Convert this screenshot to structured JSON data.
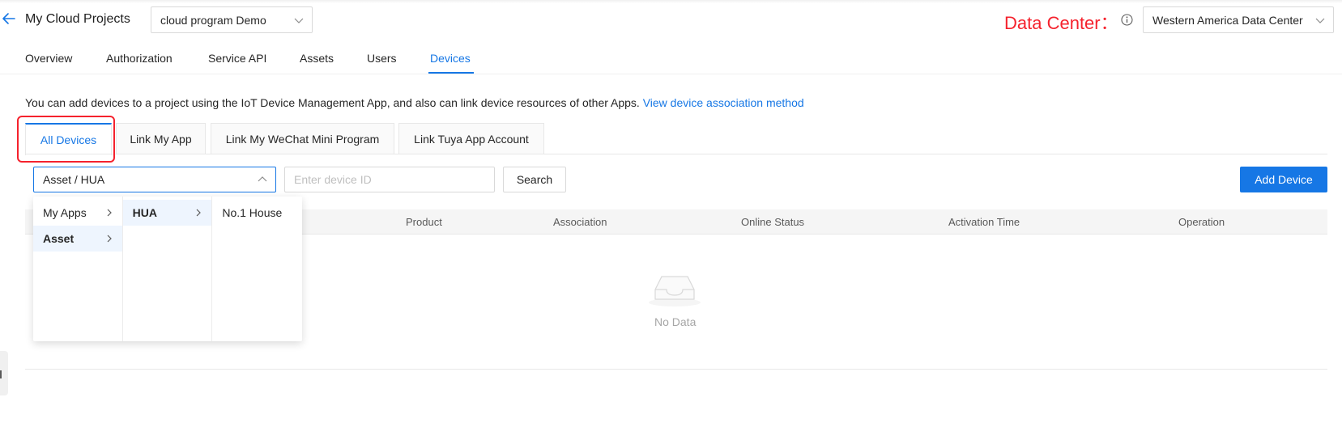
{
  "header": {
    "title": "My Cloud Projects",
    "project_select": "cloud program Demo",
    "data_center_label": "Data Center：",
    "data_center_select": "Western America Data Center"
  },
  "nav_tabs": [
    "Overview",
    "Authorization",
    "Service API",
    "Assets",
    "Users",
    "Devices"
  ],
  "active_nav_tab": "Devices",
  "description": {
    "text": "You can add devices to a project using the IoT Device Management App, and also can link device resources of other Apps.",
    "link": "View device association method"
  },
  "device_tabs": [
    "All Devices",
    "Link My App",
    "Link My WeChat Mini Program",
    "Link Tuya App Account"
  ],
  "active_device_tab": "All Devices",
  "filters": {
    "cascader_value": "Asset / HUA",
    "device_id_placeholder": "Enter device ID",
    "search_label": "Search",
    "add_device_label": "Add Device"
  },
  "cascader_menu": {
    "column1": [
      {
        "label": "My Apps",
        "has_children": true,
        "selected": false
      },
      {
        "label": "Asset",
        "has_children": true,
        "selected": true
      }
    ],
    "column2": [
      {
        "label": "HUA",
        "has_children": true,
        "selected": true
      }
    ],
    "column3": [
      {
        "label": "No.1 House",
        "has_children": false,
        "selected": false
      }
    ]
  },
  "table": {
    "columns": [
      "Product",
      "Association",
      "Online Status",
      "Activation Time",
      "Operation"
    ],
    "empty_text": "No Data"
  },
  "colors": {
    "accent": "#1677e5",
    "highlight": "#f5222d"
  }
}
